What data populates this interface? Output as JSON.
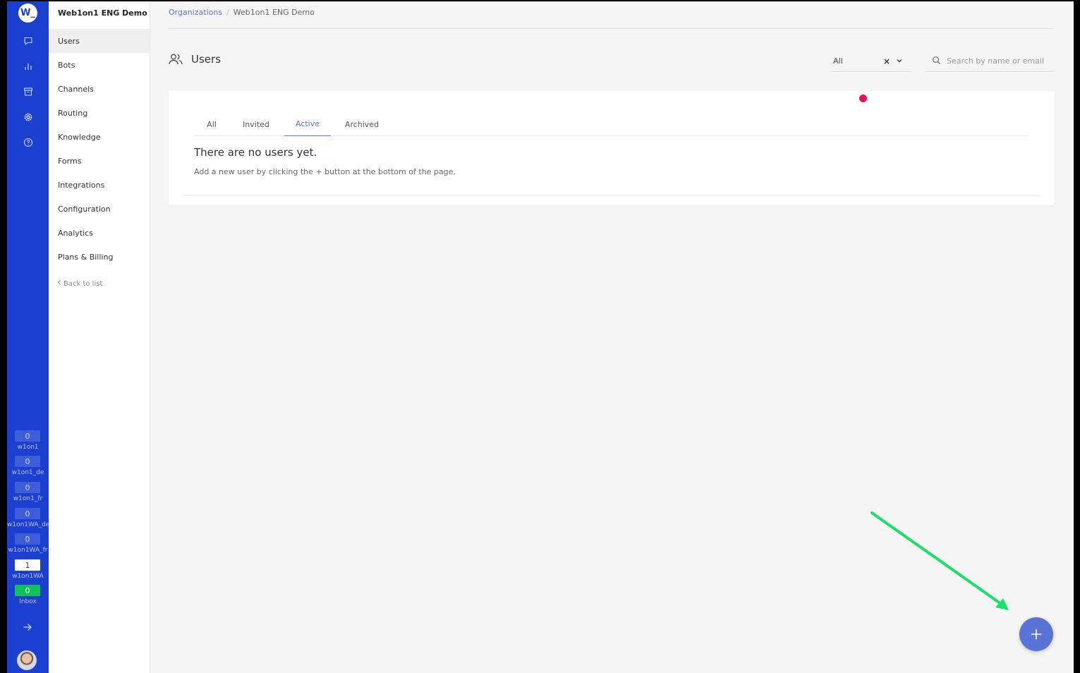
{
  "colors": {
    "rail": "#1b3fcf",
    "accent": "#5a73d6",
    "marker": "#e8115c",
    "annotation_arrow": "#1adf6b",
    "counter_green": "#10c257"
  },
  "rail": {
    "logo_text": "W_",
    "icons": [
      "chat-icon",
      "bar-chart-icon",
      "archive-icon",
      "gear-icon",
      "help-circle-icon"
    ],
    "counters": [
      {
        "value": "0",
        "label": "w1on1"
      },
      {
        "value": "0",
        "label": "w1on1_de"
      },
      {
        "value": "0",
        "label": "w1on1_fr"
      },
      {
        "value": "0",
        "label": "w1on1WA_de"
      },
      {
        "value": "0",
        "label": "w1on1WA_fr"
      },
      {
        "value": "1",
        "label": "w1on1WA"
      },
      {
        "value": "0",
        "label": "Inbox"
      }
    ]
  },
  "nav": {
    "org_name": "Web1on1 ENG Demo",
    "items": [
      {
        "label": "Users"
      },
      {
        "label": "Bots"
      },
      {
        "label": "Channels"
      },
      {
        "label": "Routing"
      },
      {
        "label": "Knowledge"
      },
      {
        "label": "Forms"
      },
      {
        "label": "Integrations"
      },
      {
        "label": "Configuration"
      },
      {
        "label": "Analytics"
      },
      {
        "label": "Plans & Billing"
      }
    ],
    "back_label": "Back to list"
  },
  "breadcrumb": {
    "root": "Organizations",
    "separator": "/",
    "current": "Web1on1 ENG Demo"
  },
  "page": {
    "title": "Users",
    "filter_value": "All",
    "filter_clear": "×",
    "search_placeholder": "Search by name or email"
  },
  "tabs": [
    {
      "label": "All"
    },
    {
      "label": "Invited"
    },
    {
      "label": "Active"
    },
    {
      "label": "Archived"
    }
  ],
  "empty_state": {
    "title": "There are no users yet.",
    "description": "Add a new user by clicking the + button at the bottom of the page."
  }
}
